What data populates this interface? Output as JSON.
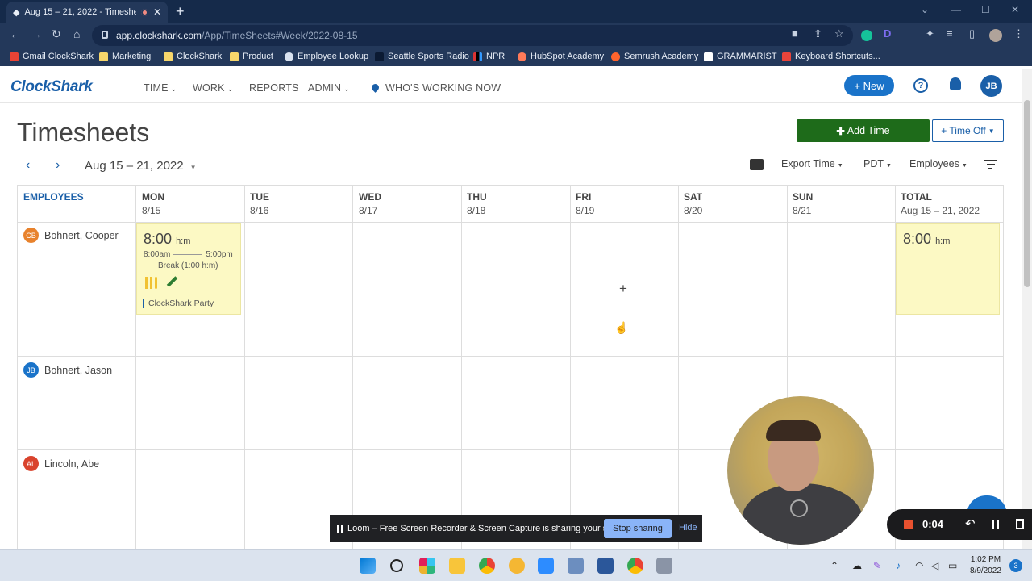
{
  "browser": {
    "tab_title": "Aug 15 – 21, 2022 - Timeshe",
    "url_host": "app.clockshark.com",
    "url_path": "/App/TimeSheets#Week/2022-08-15",
    "bookmarks": [
      "Gmail ClockShark",
      "Marketing",
      "ClockShark",
      "Product",
      "Employee Lookup",
      "Seattle Sports Radio",
      "NPR",
      "HubSpot Academy",
      "Semrush Academy",
      "GRAMMARIST",
      "Keyboard Shortcuts..."
    ]
  },
  "app": {
    "logo": "ClockShark",
    "menu": [
      "TIME",
      "WORK",
      "REPORTS",
      "ADMIN",
      "WHO'S WORKING NOW"
    ],
    "new_label": "+ New",
    "help": "?",
    "user_initials": "JB"
  },
  "page": {
    "title": "Timesheets",
    "add_time": "Add Time",
    "time_off": "+ Time Off",
    "date_range": "Aug 15 – 21, 2022",
    "export_time": "Export Time",
    "timezone": "PDT",
    "employees_filter": "Employees"
  },
  "grid": {
    "headers": [
      {
        "day": "EMPLOYEES",
        "date": ""
      },
      {
        "day": "MON",
        "date": "8/15"
      },
      {
        "day": "TUE",
        "date": "8/16"
      },
      {
        "day": "WED",
        "date": "8/17"
      },
      {
        "day": "THU",
        "date": "8/18"
      },
      {
        "day": "FRI",
        "date": "8/19"
      },
      {
        "day": "SAT",
        "date": "8/20"
      },
      {
        "day": "SUN",
        "date": "8/21"
      },
      {
        "day": "TOTAL",
        "date": "Aug 15 – 21, 2022"
      }
    ],
    "employees": [
      {
        "initials": "CB",
        "name": "Bohnert, Cooper",
        "color": "#e8822c"
      },
      {
        "initials": "JB",
        "name": "Bohnert, Jason",
        "color": "#1a73c9"
      },
      {
        "initials": "AL",
        "name": "Lincoln, Abe",
        "color": "#d9432d"
      }
    ],
    "entry": {
      "duration": "8:00",
      "unit": "h:m",
      "start": "8:00am",
      "end": "5:00pm",
      "break": "Break (1:00 h:m)",
      "job": "ClockShark Party"
    },
    "total": {
      "duration": "8:00",
      "unit": "h:m"
    },
    "add_symbol": "+"
  },
  "loom": {
    "message": "Loom – Free Screen Recorder & Screen Capture is sharing your screen.",
    "stop_label": "Stop sharing",
    "hide_label": "Hide",
    "timer": "0:04"
  },
  "taskbar": {
    "time": "1:02 PM",
    "date": "8/9/2022",
    "notifications": "3"
  }
}
